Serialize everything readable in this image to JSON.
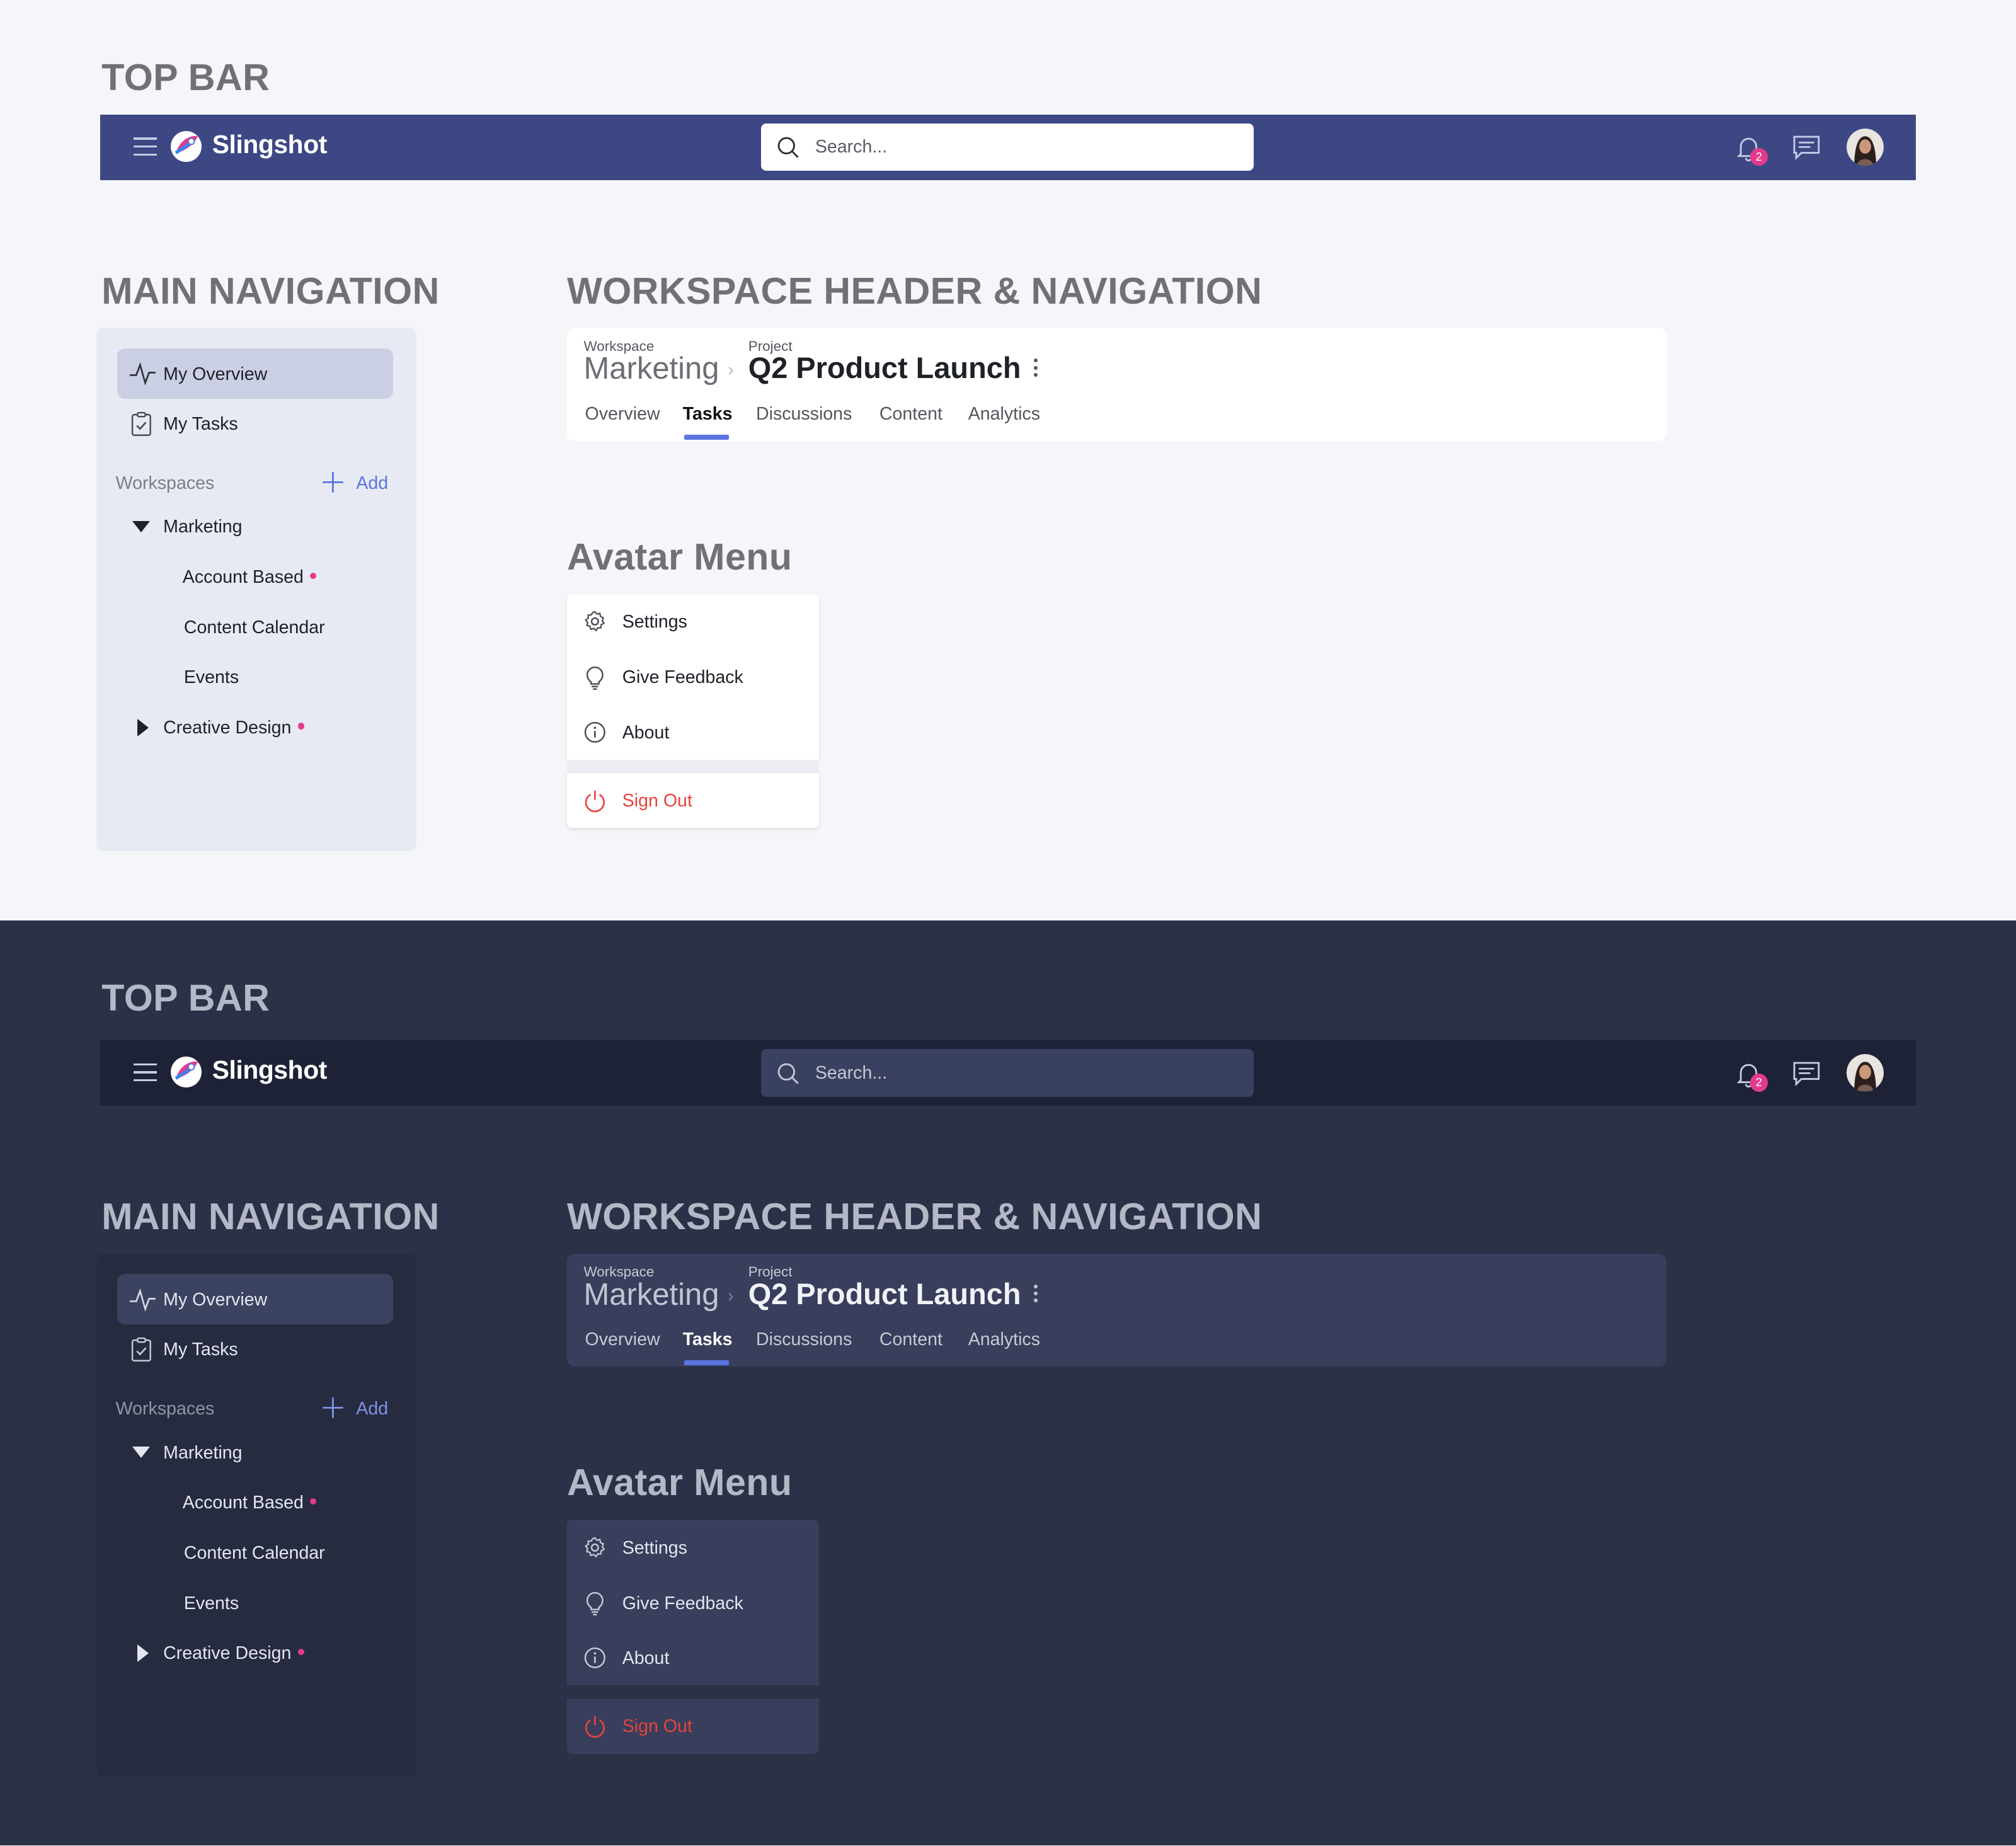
{
  "headings": {
    "top_bar": "TOP BAR",
    "main_navigation": "MAIN NAVIGATION",
    "workspace_header": "WORKSPACE HEADER  & NAVIGATION",
    "avatar_menu": "Avatar Menu"
  },
  "topbar": {
    "brand": "Slingshot",
    "search_placeholder": "Search...",
    "notification_count": "2"
  },
  "mainnav": {
    "items": [
      {
        "label": "My Overview",
        "icon": "activity-icon",
        "active": true
      },
      {
        "label": "My Tasks",
        "icon": "clipboard-check-icon",
        "active": false
      }
    ],
    "workspaces_label": "Workspaces",
    "add_label": "Add",
    "tree": {
      "marketing": "Marketing",
      "account_based": "Account Based",
      "content_calendar": "Content Calendar",
      "events": "Events",
      "creative_design": "Creative Design"
    }
  },
  "workspace_header": {
    "workspace_caption": "Workspace",
    "workspace_name": "Marketing",
    "separator": "›",
    "project_caption": "Project",
    "project_name": "Q2 Product Launch",
    "tabs": [
      "Overview",
      "Tasks",
      "Discussions",
      "Content",
      "Analytics"
    ],
    "selected_tab": "Tasks"
  },
  "avatar_menu": {
    "items": [
      {
        "label": "Settings",
        "icon": "gear-icon"
      },
      {
        "label": "Give Feedback",
        "icon": "lightbulb-icon"
      },
      {
        "label": "About",
        "icon": "info-icon"
      }
    ],
    "sign_out": "Sign Out",
    "sign_out_icon": "power-icon"
  },
  "colors": {
    "light_topbar": "#3d4784",
    "dark_topbar": "#1e2236",
    "accent": "#5a74e0",
    "badge": "#e33b8c",
    "danger": "#e5443f"
  }
}
